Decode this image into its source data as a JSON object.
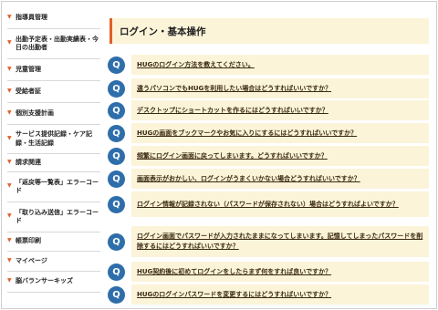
{
  "sidebar": {
    "items": [
      {
        "label": "指導員管理"
      },
      {
        "label": "出勤予定表・出勤実績表・今日の出勤者"
      },
      {
        "label": "児童管理"
      },
      {
        "label": "受給者証"
      },
      {
        "label": "個別支援計画"
      },
      {
        "label": "サービス提供記録・ケア記録・生活記録"
      },
      {
        "label": "請求関連"
      },
      {
        "label": "「返戻等一覧表」エラーコード"
      },
      {
        "label": "「取り込み送信」エラーコード"
      },
      {
        "label": "帳票印刷"
      },
      {
        "label": "マイページ"
      },
      {
        "label": "脳バランサーキッズ"
      }
    ]
  },
  "main": {
    "title": "ログイン・基本操作",
    "badge_letter": "Q",
    "questions": [
      {
        "text": "HUGのログイン方法を教えてください。"
      },
      {
        "text": "違うパソコンでもHUGを利用したい場合はどうすればいいですか？"
      },
      {
        "text": "デスクトップにショートカットを作るにはどうすればいいですか？"
      },
      {
        "text": "HUGの画面をブックマークやお気に入りにするにはどうすればいいですか？"
      },
      {
        "text": "頻繁にログイン画面に戻ってしまいます。どうすればいいですか？"
      },
      {
        "text": "画面表示がおかしい、ログインがうまくいかない場合どうすればいいですか？"
      },
      {
        "text": "ログイン情報が記録されない（パスワードが保存されない）場合はどうすればよいですか？"
      },
      {
        "text": "ログイン画面でパスワードが入力されたままになってしまいます。記憶してしまったパスワードを削除するにはどうすればいいですか？"
      },
      {
        "text": "HUG契約後に初めてログインをしたらまず何をすれば良いですか？"
      },
      {
        "text": "HUGのログインパスワードを変更するにはどうすればいいですか？"
      }
    ]
  },
  "colors": {
    "accent": "#e0602a",
    "badge": "#2e6eaa",
    "panel": "#fbf4d9"
  }
}
